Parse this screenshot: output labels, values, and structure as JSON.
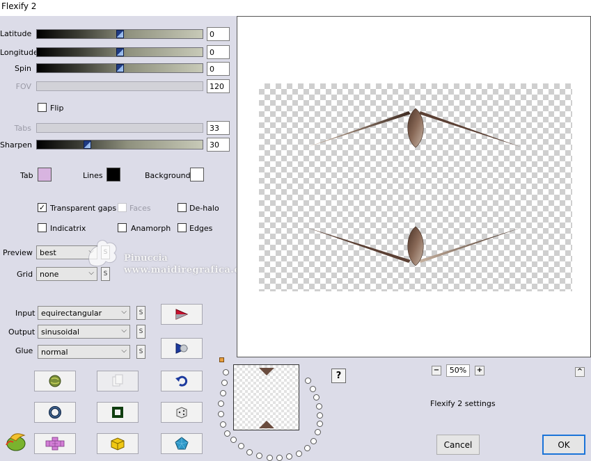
{
  "window": {
    "title": "Flexify 2"
  },
  "sliders": [
    {
      "label": "Latitude",
      "value": "0",
      "disabled": false,
      "level": 0.5
    },
    {
      "label": "Longitude",
      "value": "0",
      "disabled": false,
      "level": 0.5
    },
    {
      "label": "Spin",
      "value": "0",
      "disabled": false,
      "level": 0.5
    },
    {
      "label": "FOV",
      "value": "120",
      "disabled": true
    },
    {
      "label": "Tabs",
      "value": "33",
      "disabled": true
    },
    {
      "label": "Sharpen",
      "value": "30",
      "disabled": false,
      "level": 0.3
    }
  ],
  "flip": {
    "label": "Flip",
    "checked": false
  },
  "colors": {
    "tab": {
      "label": "Tab",
      "color": "#d8b4e0"
    },
    "lines": {
      "label": "Lines",
      "color": "#000000"
    },
    "background": {
      "label": "Background",
      "color": "#ffffff"
    }
  },
  "checkboxes": {
    "transparent_gaps": {
      "label": "Transparent gaps",
      "checked": true
    },
    "faces": {
      "label": "Faces",
      "checked": false,
      "disabled": true
    },
    "de_halo": {
      "label": "De-halo",
      "checked": false
    },
    "indicatrix": {
      "label": "Indicatrix",
      "checked": false
    },
    "anamorph": {
      "label": "Anamorph",
      "checked": false
    },
    "edges": {
      "label": "Edges",
      "checked": false
    }
  },
  "preview_select": {
    "label": "Preview",
    "value": "best"
  },
  "grid_select": {
    "label": "Grid",
    "value": "none"
  },
  "input_select": {
    "label": "Input",
    "value": "equirectangular"
  },
  "output_select": {
    "label": "Output",
    "value": "sinusoidal"
  },
  "glue_select": {
    "label": "Glue",
    "value": "normal"
  },
  "small_s": "S",
  "watermark": {
    "name": "Pinuccia",
    "site": "www.maidiregrafica.eu"
  },
  "zoom": {
    "minus": "−",
    "value": "50%",
    "plus": "+"
  },
  "settings_label": "Flexify 2 settings",
  "help_label": "?",
  "collapse_label": "^",
  "buttons": {
    "cancel": "Cancel",
    "ok": "OK"
  },
  "icons": {
    "play_red": "play-red-icon",
    "play_blue": "play-blue-icon",
    "globe": "globe-icon",
    "copy": "copy-icon",
    "undo": "undo-icon",
    "ring": "ring-icon",
    "square": "square-frame-icon",
    "dice": "dice-icon",
    "plugin_logo": "plugin-logo-icon",
    "cross": "cross-icon",
    "cube": "cube-icon",
    "pentagon": "pentagon-icon"
  }
}
